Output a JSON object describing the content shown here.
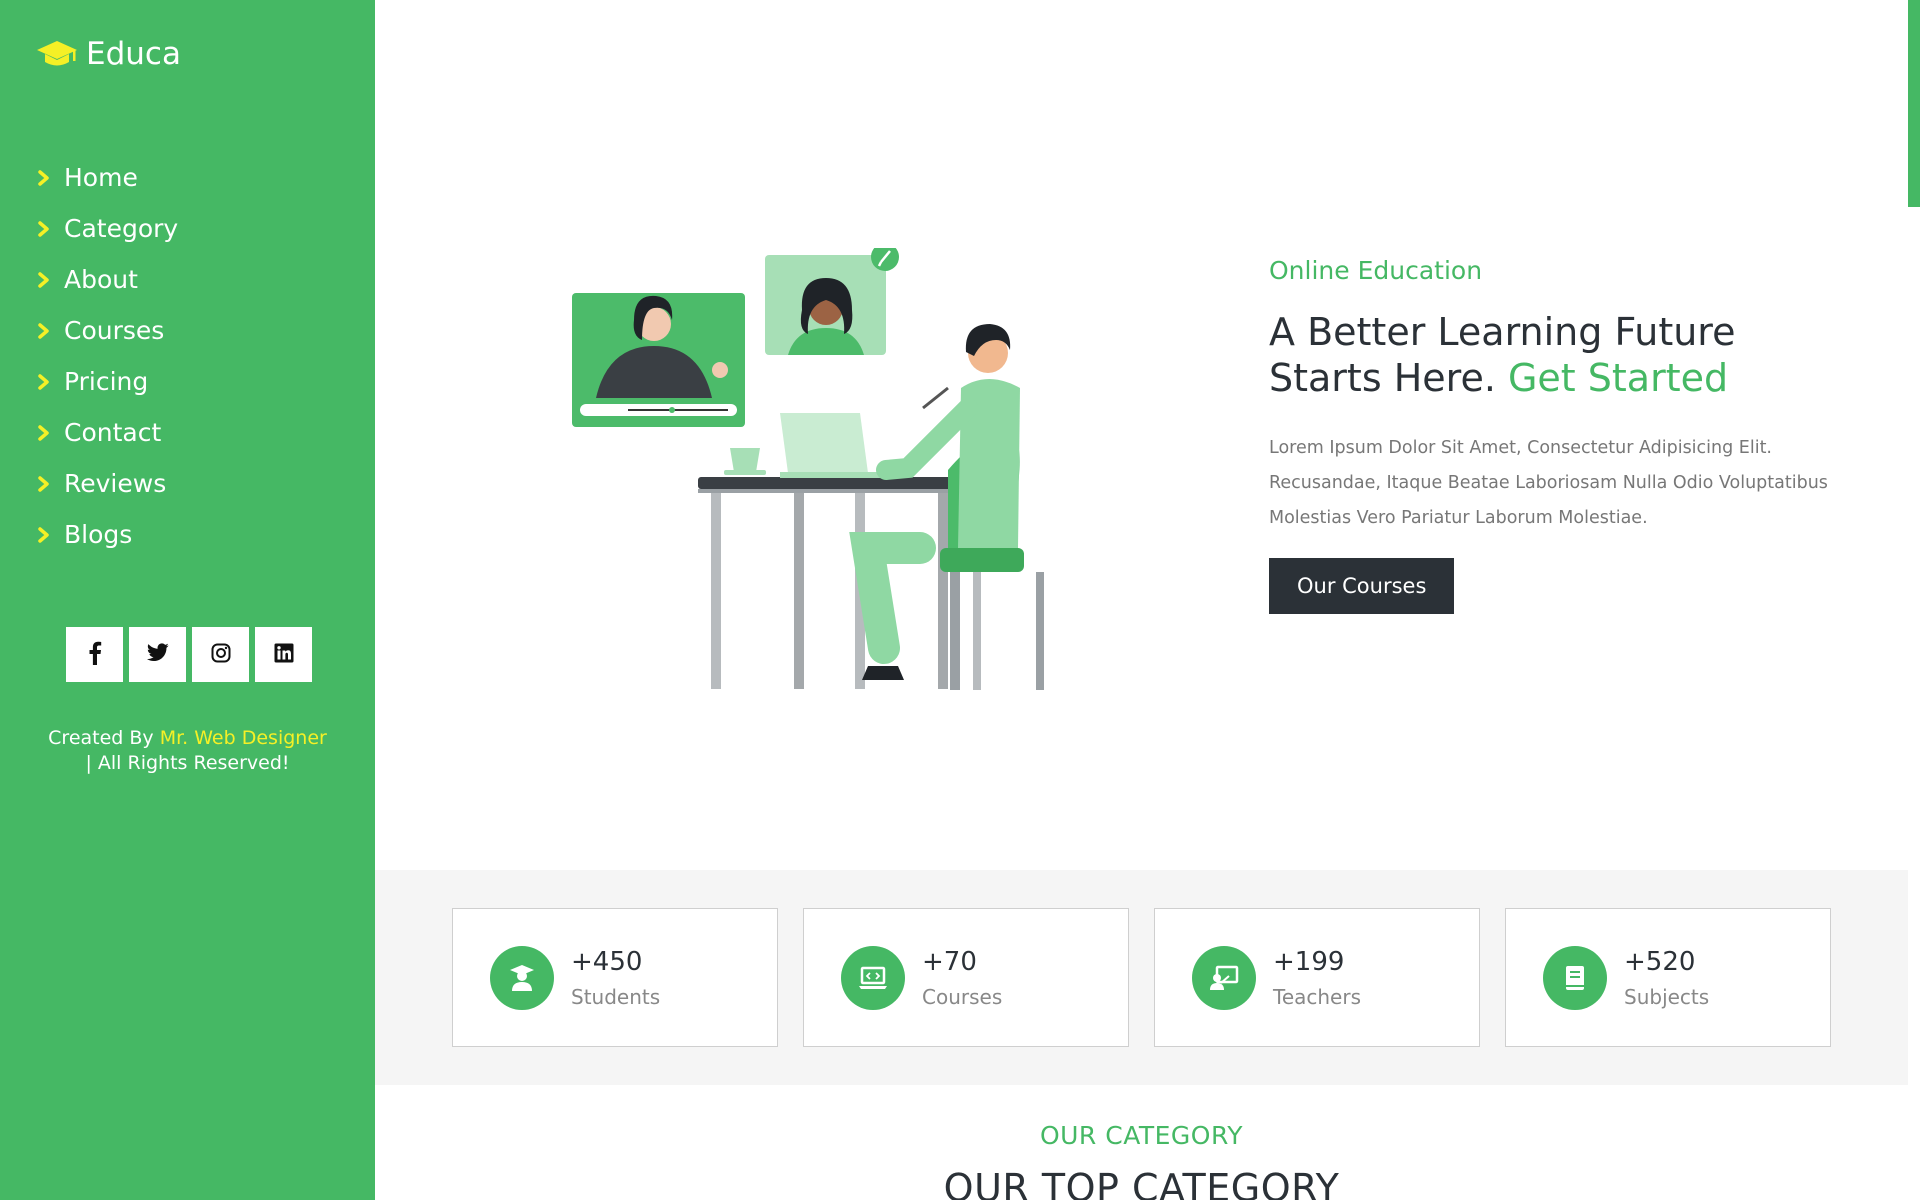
{
  "brand": {
    "name": "Educa",
    "icon": "graduation-cap-icon"
  },
  "sidebar": {
    "nav": [
      {
        "label": "Home"
      },
      {
        "label": "Category"
      },
      {
        "label": "About"
      },
      {
        "label": "Courses"
      },
      {
        "label": "Pricing"
      },
      {
        "label": "Contact"
      },
      {
        "label": "Reviews"
      },
      {
        "label": "Blogs"
      }
    ],
    "socials": [
      "facebook-icon",
      "twitter-icon",
      "instagram-icon",
      "linkedin-icon"
    ],
    "credit": {
      "prefix": "Created By ",
      "author": "Mr. Web Designer",
      "suffix": "| All Rights Reserved!"
    }
  },
  "hero": {
    "kicker": "Online Education",
    "title_line1": "A Better Learning Future",
    "title_line2": "Starts Here. ",
    "title_accent": "Get Started",
    "description": "Lorem Ipsum Dolor Sit Amet, Consectetur Adipisicing Elit. Recusandae, Itaque Beatae Laboriosam Nulla Odio Voluptatibus Molestias Vero Pariatur Laborum Molestiae.",
    "button": "Our Courses"
  },
  "stats": [
    {
      "value": "+450",
      "label": "Students",
      "icon": "student-icon"
    },
    {
      "value": "+70",
      "label": "Courses",
      "icon": "laptop-code-icon"
    },
    {
      "value": "+199",
      "label": "Teachers",
      "icon": "teacher-icon"
    },
    {
      "value": "+520",
      "label": "Subjects",
      "icon": "book-icon"
    }
  ],
  "category": {
    "kicker": "OUR CATEGORY",
    "title": "OUR TOP CATEGORY"
  },
  "colors": {
    "accent": "#45b864",
    "dark": "#2b3137",
    "highlight": "#f5f026"
  }
}
